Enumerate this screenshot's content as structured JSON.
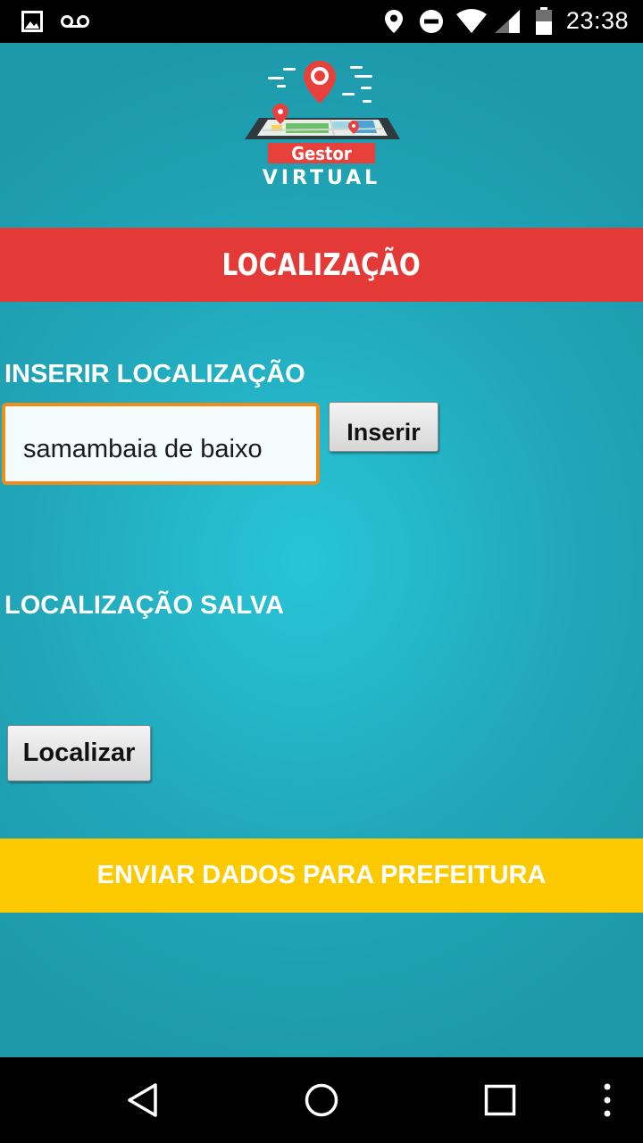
{
  "status_bar": {
    "time": "23:38",
    "icons": [
      "image-icon",
      "voicemail-icon",
      "location-pin-icon",
      "do-not-disturb-icon",
      "wifi-icon",
      "cell-signal-icon",
      "battery-icon"
    ]
  },
  "logo": {
    "line1": "Gestor",
    "line2": "VIRTUAL"
  },
  "header": {
    "title": "LOCALIZAÇÃO"
  },
  "insert_section": {
    "label": "INSERIR LOCALIZAÇÃO",
    "input_value": "samambaia de baixo",
    "button_label": "Inserir"
  },
  "saved_section": {
    "label": "LOCALIZAÇÃO SALVA"
  },
  "locate_button": {
    "label": "Localizar"
  },
  "send_button": {
    "label": "ENVIAR DADOS PARA PREFEITURA"
  },
  "nav_bar": {
    "icons": [
      "back-icon",
      "home-icon",
      "recents-icon",
      "overflow-menu-icon"
    ]
  },
  "colors": {
    "background": "#21a6b9",
    "banner": "#e33a37",
    "send_button": "#fdc900",
    "input_border": "#f08c1b"
  }
}
